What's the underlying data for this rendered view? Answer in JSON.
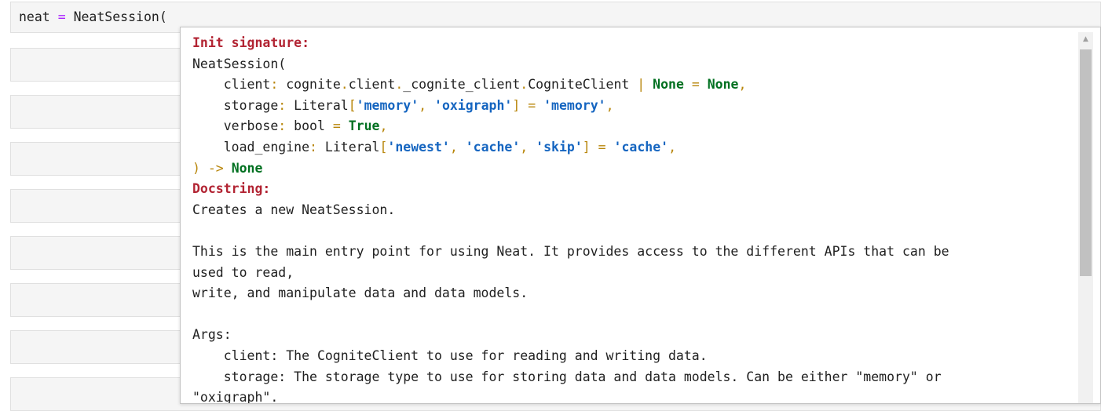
{
  "cell": {
    "var": "neat",
    "op": "=",
    "call": "NeatSession("
  },
  "tooltip": {
    "init_header": "Init signature:",
    "sig_open": "NeatSession(",
    "client_line": {
      "indent": "    ",
      "name": "client",
      "colon": ":",
      "t1": " cognite",
      "dot1": ".",
      "t2": "client",
      "dot2": ".",
      "t3": "_cognite_client",
      "dot3": ".",
      "t4": "CogniteClient ",
      "pipe": "|",
      "sp": " ",
      "none1": "None",
      "eq": " = ",
      "none2": "None",
      "comma": ","
    },
    "storage_line": {
      "indent": "    ",
      "name": "storage",
      "colon": ":",
      "type": " Literal",
      "lb": "[",
      "s1": "'memory'",
      "c1": ", ",
      "s2": "'oxigraph'",
      "rb": "]",
      "eq": " = ",
      "default": "'memory'",
      "comma": ","
    },
    "verbose_line": {
      "indent": "    ",
      "name": "verbose",
      "colon": ":",
      "type": " bool",
      "eq": " = ",
      "default": "True",
      "comma": ","
    },
    "engine_line": {
      "indent": "    ",
      "name": "load_engine",
      "colon": ":",
      "type": " Literal",
      "lb": "[",
      "s1": "'newest'",
      "c1": ", ",
      "s2": "'cache'",
      "c2": ", ",
      "s3": "'skip'",
      "rb": "]",
      "eq": " = ",
      "default": "'cache'",
      "comma": ","
    },
    "close_line": {
      "paren": ")",
      "arrow": " -> ",
      "ret": "None"
    },
    "doc_header": "Docstring:",
    "doc_lines": [
      "Creates a new NeatSession.",
      "",
      "This is the main entry point for using Neat. It provides access to the different APIs that can be",
      "used to read,",
      "write, and manipulate data and data models.",
      "",
      "Args:",
      "    client: The CogniteClient to use for reading and writing data.",
      "    storage: The storage type to use for storing data and data models. Can be either \"memory\" or",
      "\"oxigraph\"."
    ]
  },
  "scrollbar": {
    "up_icon": "▲"
  }
}
